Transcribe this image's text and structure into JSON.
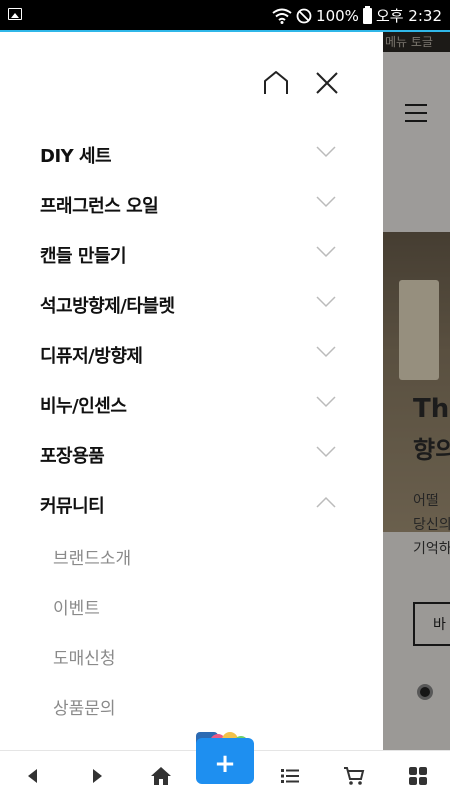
{
  "status_bar": {
    "battery": "100%",
    "time": "오후 2:32"
  },
  "background_page": {
    "top_strip": "메뉴 토글",
    "hero_title_1": "Th",
    "hero_title_2": "향의",
    "hero_text_1": "어떨",
    "hero_text_2": "당신의",
    "hero_text_3": "기억하",
    "hero_button": "바"
  },
  "drawer": {
    "menu": [
      {
        "label": "DIY 세트",
        "expanded": false
      },
      {
        "label": "프래그런스 오일",
        "expanded": false
      },
      {
        "label": "캔들 만들기",
        "expanded": false
      },
      {
        "label": "석고방향제/타블렛",
        "expanded": false
      },
      {
        "label": "디퓨저/방향제",
        "expanded": false
      },
      {
        "label": "비누/인센스",
        "expanded": false
      },
      {
        "label": "포장용품",
        "expanded": false
      },
      {
        "label": "커뮤니티",
        "expanded": true
      }
    ],
    "submenu": [
      "브랜드소개",
      "이벤트",
      "도매신청",
      "상품문의"
    ]
  },
  "bottom_nav": {
    "fab_icon": "folder-add-icon",
    "buttons": [
      "back-arrow-icon",
      "forward-arrow-icon",
      "home-icon",
      "list-icon",
      "cart-icon",
      "grid-icon"
    ]
  },
  "colors": {
    "accent": "#30b7e8",
    "fab": "#1e8ff0",
    "submenu_text": "#8a8a8a"
  }
}
